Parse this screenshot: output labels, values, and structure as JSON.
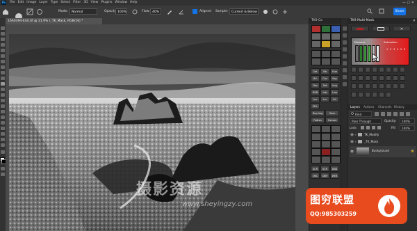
{
  "app": {
    "logo": "Ps",
    "menu": [
      "File",
      "Edit",
      "Image",
      "Layer",
      "Type",
      "Select",
      "Filter",
      "3D",
      "View",
      "Plugins",
      "Window",
      "Help"
    ],
    "window_controls": "—  ▢  ✕"
  },
  "options_bar": {
    "mode_label": "Mode:",
    "mode_value": "Normal",
    "opacity_label": "Opacity:",
    "opacity_value": "100%",
    "flow_label": "Flow:",
    "flow_value": "40%",
    "aligned_label": "Aligned",
    "sample_label": "Sample:",
    "sample_value": "Current & Below",
    "share_label": "Share"
  },
  "document": {
    "tab_title": "16A0394-Edit.tif @ 21.9% (_TK_Mask, RGB/16) *"
  },
  "tk_cc": {
    "title": "TK9 Co",
    "buttons": [
      "Sat",
      "Vib",
      "Hue",
      "Bri",
      "Con",
      "Exp",
      "Rez",
      "Sat",
      "Img",
      "RGB",
      "Lab",
      "Lum",
      "Luc",
      "Lcc",
      "LLL",
      "MLL",
      "Dup Img",
      "Save",
      "Flatten",
      "Canvas",
      "ACR",
      "ACR",
      "DBD",
      "OBC",
      "SBM",
      "WEB"
    ]
  },
  "tk_mm": {
    "title": "TK9 Multi-Mask",
    "close": "✕",
    "btn_left": "",
    "btn_middle": "✕",
    "zone_left": "Vibrance",
    "zone_right": "Saturation",
    "zone_numbers": [
      "1",
      "2",
      "3",
      "4",
      "5",
      "6"
    ]
  },
  "layers": {
    "tabs": [
      "Layers",
      "Actions",
      "Channels",
      "History"
    ],
    "search_value": "Kind",
    "blend_value": "Pass Through",
    "opacity_label": "Opacity:",
    "opacity_value": "100%",
    "lock_label": "Lock:",
    "fill_label": "Fill:",
    "fill_value": "100%",
    "group_name": "TK_Modify",
    "mask_name": "_TK_Mask",
    "layer_name": "Background"
  },
  "watermark": {
    "badge_title": "图穷联盟",
    "badge_qq": "QQ:985303259",
    "center_text": "摄影资源",
    "url": "www.sheyingzy.com"
  },
  "colors": {
    "accent": "#1473e6",
    "badge": "#e84b1e",
    "mask_red": "#e41b1b"
  }
}
